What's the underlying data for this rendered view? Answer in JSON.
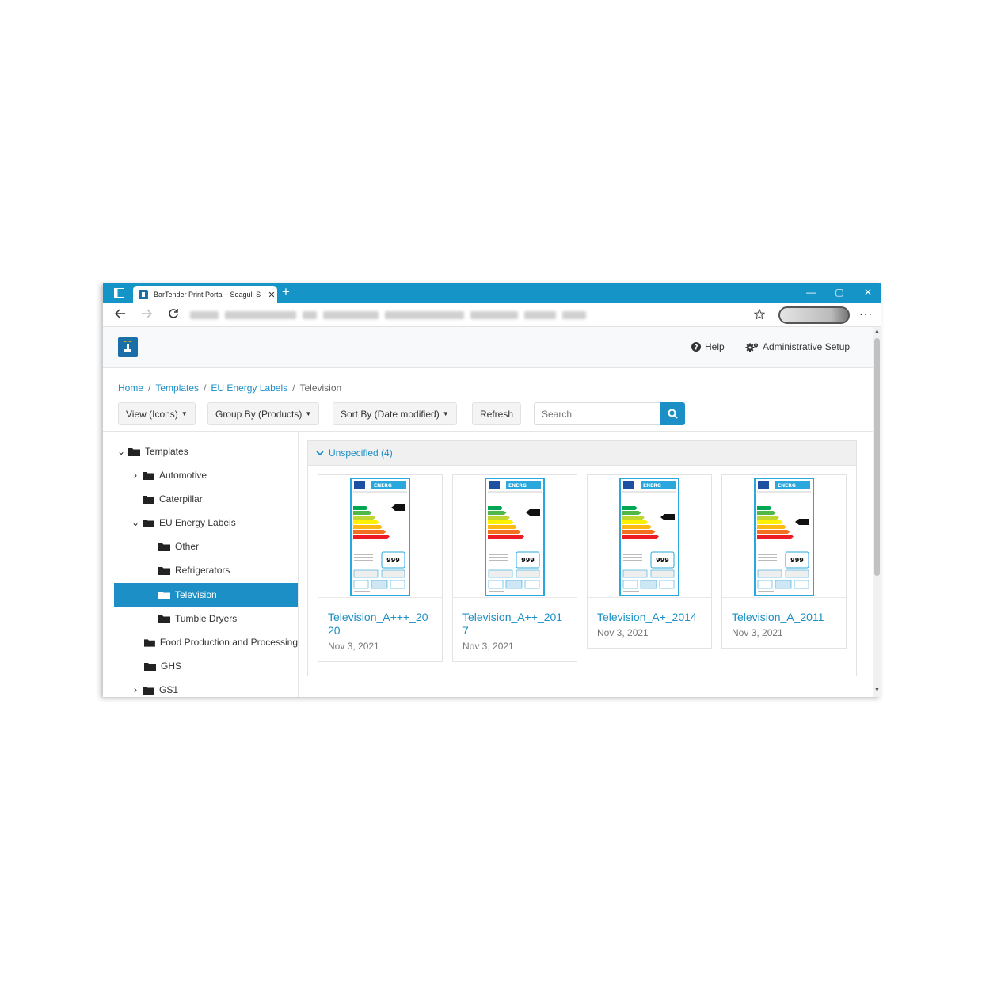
{
  "browser": {
    "tab_title": "BarTender Print Portal - Seagull S",
    "tab_close": "✕",
    "new_tab": "+",
    "window_controls": [
      "—",
      "▢",
      "✕"
    ],
    "back_icon": "arrow-left",
    "forward_icon": "arrow-right",
    "reload_icon": "reload",
    "more": "···"
  },
  "header": {
    "help_label": "Help",
    "admin_label": "Administrative Setup"
  },
  "breadcrumb": {
    "items": [
      "Home",
      "Templates",
      "EU Energy Labels"
    ],
    "current": "Television",
    "separator": "/"
  },
  "toolbar": {
    "view_label": "View (Icons)",
    "group_label": "Group By (Products)",
    "sort_label": "Sort By (Date modified)",
    "refresh_label": "Refresh",
    "search_placeholder": "Search"
  },
  "tree": {
    "items": [
      {
        "label": "Templates",
        "chevron": "down",
        "level": 0
      },
      {
        "label": "Automotive",
        "chevron": "right",
        "level": 1
      },
      {
        "label": "Caterpillar",
        "chevron": "",
        "level": 1
      },
      {
        "label": "EU Energy Labels",
        "chevron": "down",
        "level": 1
      },
      {
        "label": "Other",
        "chevron": "",
        "level": 2
      },
      {
        "label": "Refrigerators",
        "chevron": "",
        "level": 2
      },
      {
        "label": "Television",
        "chevron": "",
        "level": 2,
        "selected": true
      },
      {
        "label": "Tumble Dryers",
        "chevron": "",
        "level": 2
      },
      {
        "label": "Food Production and Processing",
        "chevron": "",
        "level": 1
      },
      {
        "label": "GHS",
        "chevron": "",
        "level": 1
      },
      {
        "label": "GS1",
        "chevron": "right",
        "level": 1
      }
    ]
  },
  "group": {
    "label": "Unspecified (4)",
    "cards": [
      {
        "name": "Television_A+++_2020",
        "date": "Nov 3, 2021"
      },
      {
        "name": "Television_A++_2017",
        "date": "Nov 3, 2021"
      },
      {
        "name": "Television_A+_2014",
        "date": "Nov 3, 2021"
      },
      {
        "name": "Television_A_2011",
        "date": "Nov 3, 2021"
      }
    ],
    "label_thumb": {
      "heading": "ENERG",
      "value": "999"
    }
  },
  "colors": {
    "accent": "#1b8fc6",
    "titlebar": "#1594c8",
    "selected": "#1b8fc6"
  }
}
